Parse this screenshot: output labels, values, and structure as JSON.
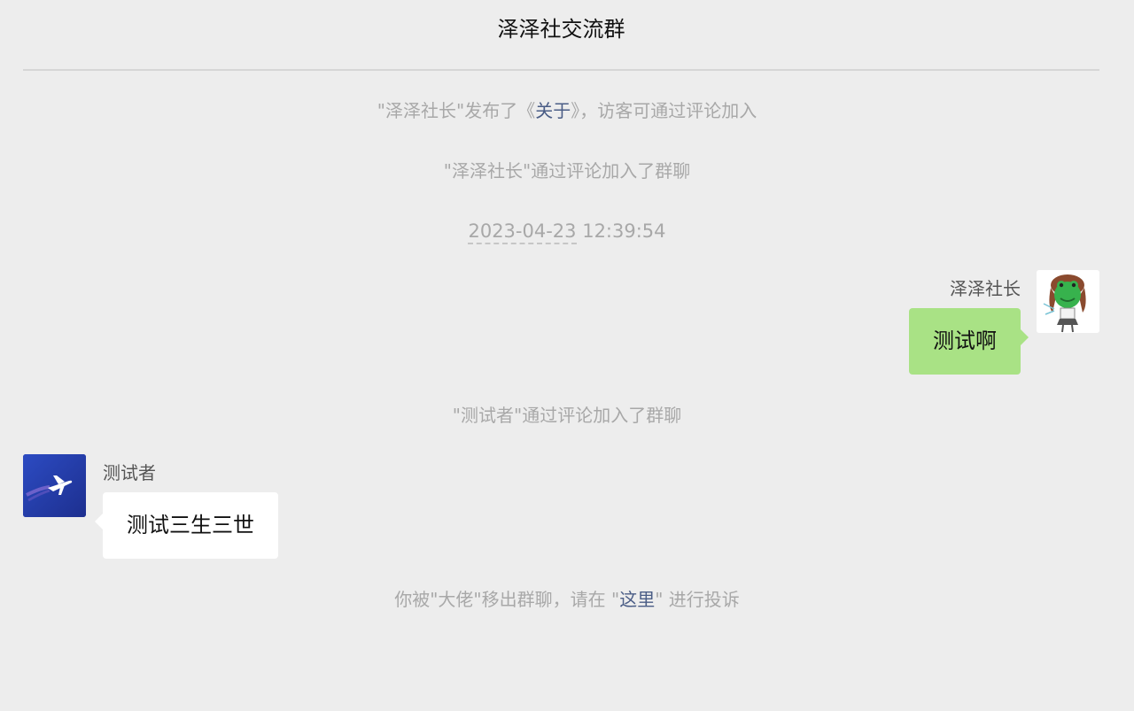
{
  "header": {
    "title": "泽泽社交流群"
  },
  "system_messages": {
    "published": {
      "prefix": "\"泽泽社长\"发布了《",
      "link": "关于",
      "suffix": "》，访客可通过评论加入"
    },
    "joined_host": "\"泽泽社长\"通过评论加入了群聊",
    "joined_tester": "\"测试者\"通过评论加入了群聊",
    "kicked": {
      "prefix": "你被\"大佬\"移出群聊，请在 \"",
      "link": "这里",
      "suffix": "\" 进行投诉"
    }
  },
  "timestamp": {
    "date": "2023-04-23",
    "time": "12:39:54"
  },
  "messages": [
    {
      "sender": "泽泽社长",
      "text": "测试啊",
      "side": "right",
      "bubble_color": "#a9e285",
      "avatar_icon": "frog-girl-avatar"
    },
    {
      "sender": "测试者",
      "text": "测试三生三世",
      "side": "left",
      "bubble_color": "#ffffff",
      "avatar_icon": "airplane-avatar"
    }
  ],
  "colors": {
    "background": "#ededed",
    "system_text": "#a8a8a8",
    "link": "#4a5d86"
  }
}
